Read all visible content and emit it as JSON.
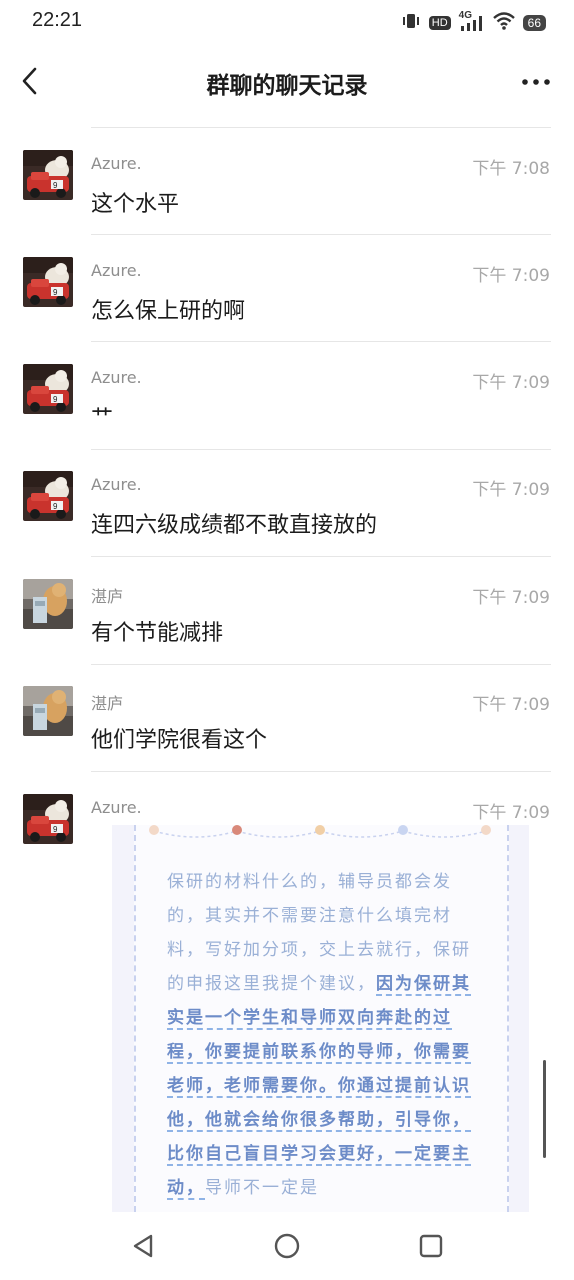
{
  "status_bar": {
    "time": "22:21",
    "hd": "HD",
    "network": "4G",
    "battery": "66"
  },
  "header": {
    "title": "群聊的聊天记录"
  },
  "messages": [
    {
      "sender": "Azure.",
      "time": "下午 7:08",
      "text": "这个水平",
      "avatar": "azure"
    },
    {
      "sender": "Azure.",
      "time": "下午 7:09",
      "text": "怎么保上研的啊",
      "avatar": "azure"
    },
    {
      "sender": "Azure.",
      "time": "下午 7:09",
      "text": "艹",
      "avatar": "azure"
    },
    {
      "sender": "Azure.",
      "time": "下午 7:09",
      "text": "连四六级成绩都不敢直接放的",
      "avatar": "azure"
    },
    {
      "sender": "湛庐",
      "time": "下午 7:09",
      "text": "有个节能减排",
      "avatar": "zhanlu"
    },
    {
      "sender": "湛庐",
      "time": "下午 7:09",
      "text": "他们学院很看这个",
      "avatar": "zhanlu"
    },
    {
      "sender": "Azure.",
      "time": "下午 7:09",
      "text": "",
      "avatar": "azure"
    }
  ],
  "image_card": {
    "plain_text": "保研的材料什么的，辅导员都会发的，其实并不需要注意什么填完材料，写好加分项，交上去就行，保研的申报这里我提个建议，",
    "highlight_text": "因为保研其实是一个学生和导师双向奔赴的过程，你要提前联系你的导师，你需要老师，老师需要你。你通过提前认识他，他就会给你很多帮助，引导你，比你自己盲目学习会更好，一定要主动，",
    "tail_text": "导师不一定是",
    "dot_colors": [
      "#f3d9c8",
      "#d9897a",
      "#f1cfa6",
      "#c9d5f1",
      "#f3d9c8"
    ]
  },
  "nav": {
    "back": "back-triangle-icon",
    "home": "home-circle-icon",
    "recents": "recents-square-icon"
  }
}
